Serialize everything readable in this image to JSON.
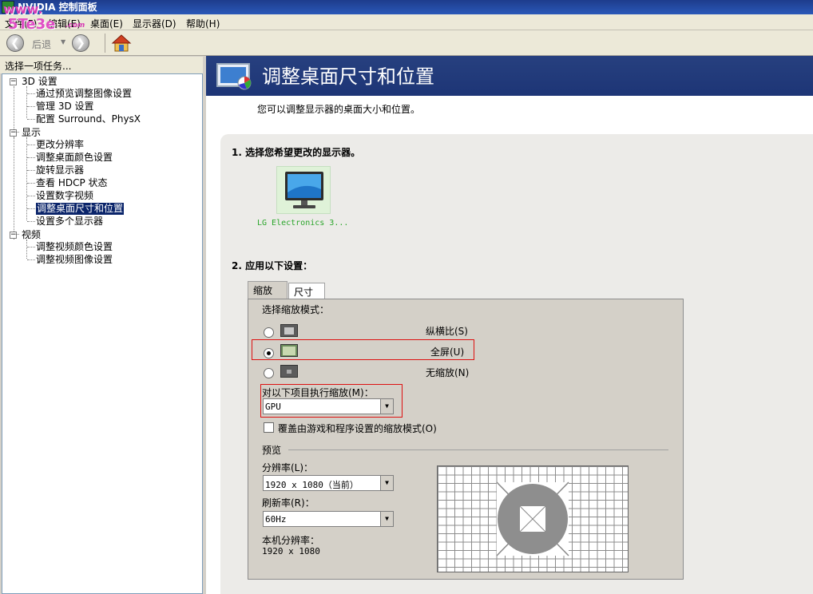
{
  "window": {
    "title": "NVIDIA 控制面板"
  },
  "watermark": {
    "line1": "www.",
    "line2": "5Te3e",
    "line3": ".com"
  },
  "menu": {
    "file": "文件(F)",
    "edit": "编辑(E)",
    "desktop": "桌面(E)",
    "display": "显示器(D)",
    "help": "帮助(H)"
  },
  "toolbar": {
    "back_label": "后退"
  },
  "left_pane": {
    "header": "选择一项任务...",
    "tree": [
      {
        "label": "3D 设置",
        "children": [
          "通过预览调整图像设置",
          "管理 3D 设置",
          "配置 Surround、PhysX"
        ]
      },
      {
        "label": "显示",
        "children": [
          "更改分辨率",
          "调整桌面颜色设置",
          "旋转显示器",
          "查看 HDCP 状态",
          "设置数字视频",
          "调整桌面尺寸和位置",
          "设置多个显示器"
        ]
      },
      {
        "label": "视频",
        "children": [
          "调整视频颜色设置",
          "调整视频图像设置"
        ]
      }
    ],
    "selected": "调整桌面尺寸和位置"
  },
  "page": {
    "title": "调整桌面尺寸和位置",
    "description": "您可以调整显示器的桌面大小和位置。",
    "step1": "1. 选择您希望更改的显示器。",
    "monitor_name": "LG Electronics 3...",
    "step2": "2. 应用以下设置："
  },
  "tabs": [
    "缩放",
    "尺寸"
  ],
  "scaling": {
    "mode_label": "选择缩放模式：",
    "options": [
      {
        "label": "纵横比(S)",
        "checked": false
      },
      {
        "label": "全屏(U)",
        "checked": true
      },
      {
        "label": "无缩放(N)",
        "checked": false
      }
    ],
    "perform_label": "对以下项目执行缩放(M)：",
    "perform_value": "GPU",
    "override_label": "覆盖由游戏和程序设置的缩放模式(O)",
    "override_checked": false
  },
  "preview": {
    "group_label": "预览",
    "resolution_label": "分辨率(L)：",
    "resolution_value": "1920 x 1080（当前）",
    "refresh_label": "刷新率(R)：",
    "refresh_value": "60Hz",
    "native_label": "本机分辨率：",
    "native_value": "1920 x 1080"
  },
  "colors": {
    "banner": "#27407f",
    "selection": "#0a246a",
    "highlight_box": "#dd1111",
    "monitor_label": "#2aa52a"
  }
}
